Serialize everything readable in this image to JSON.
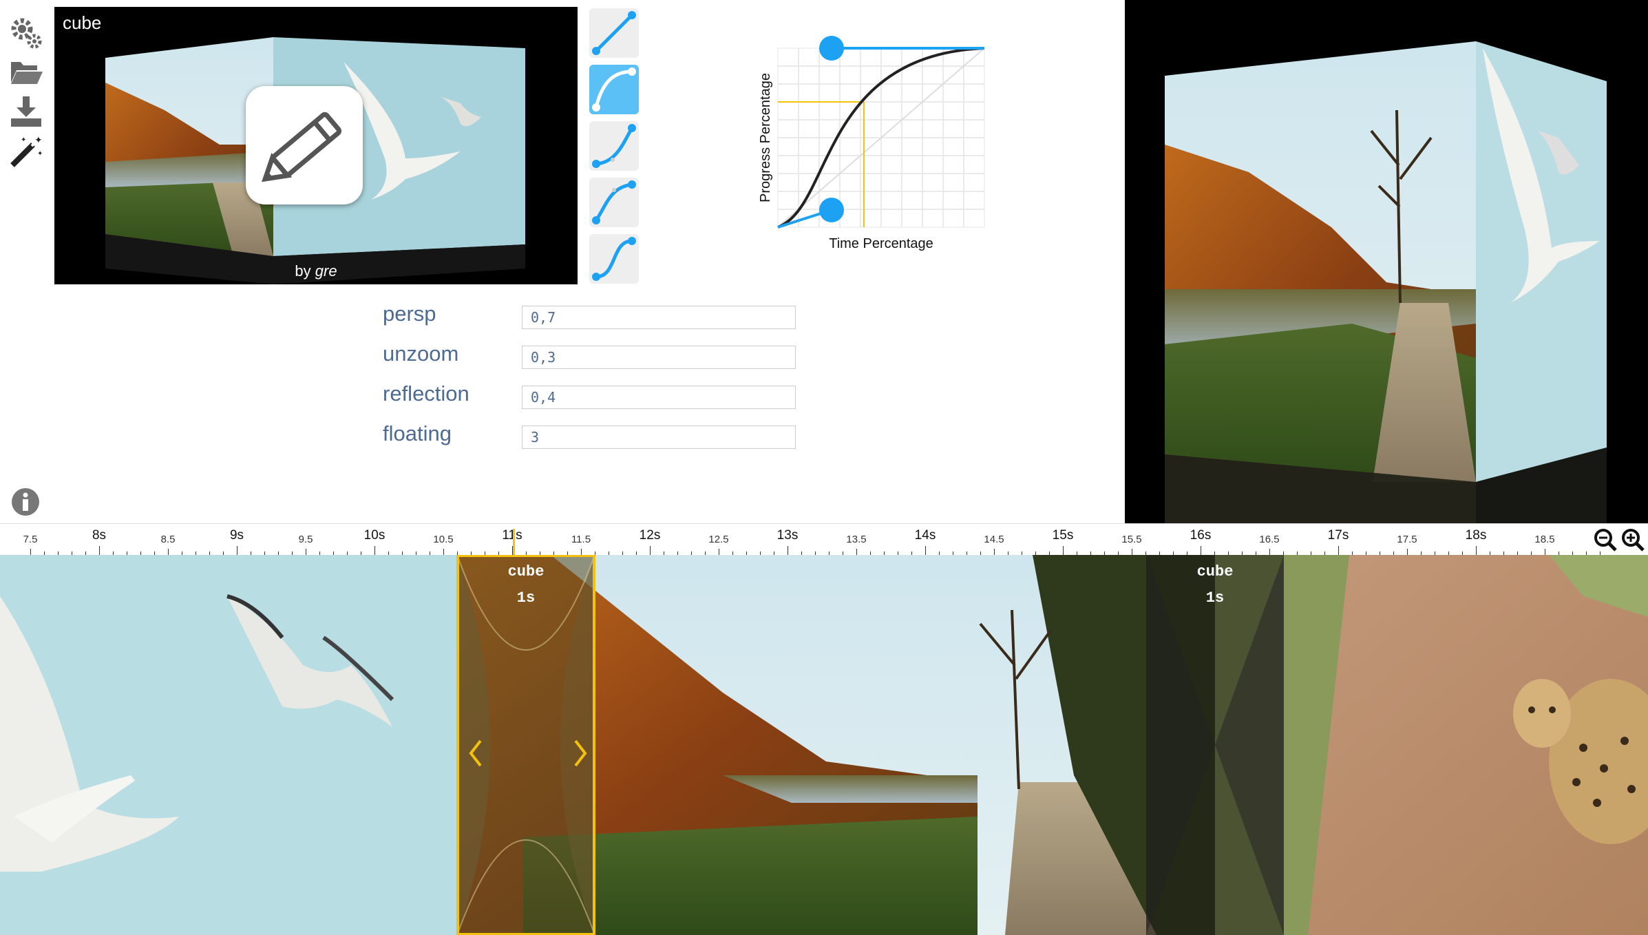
{
  "toolbar": {
    "items": [
      {
        "icon": "gear-icon"
      },
      {
        "icon": "folder-open-icon"
      },
      {
        "icon": "download-icon"
      },
      {
        "icon": "magic-wand-icon"
      }
    ],
    "info_icon": "info-icon"
  },
  "preview": {
    "title": "cube",
    "author_prefix": "by ",
    "author": "gre"
  },
  "easing": {
    "presets": [
      "linear",
      "ease",
      "ease-in",
      "ease-out",
      "ease-in-out"
    ],
    "active_index": 1,
    "graph": {
      "xlabel": "Time Percentage",
      "ylabel": "Progress Percentage"
    }
  },
  "params": [
    {
      "name": "persp",
      "value": "0,7"
    },
    {
      "name": "unzoom",
      "value": "0,3"
    },
    {
      "name": "reflection",
      "value": "0,4"
    },
    {
      "name": "floating",
      "value": "3"
    }
  ],
  "timeline": {
    "ticks": [
      {
        "label": "7.5",
        "major": false
      },
      {
        "label": "8s",
        "major": true
      },
      {
        "label": "8.5",
        "major": false
      },
      {
        "label": "9s",
        "major": true
      },
      {
        "label": "9.5",
        "major": false
      },
      {
        "label": "10s",
        "major": true
      },
      {
        "label": "10.5",
        "major": false
      },
      {
        "label": "11s",
        "major": true
      },
      {
        "label": "11.5",
        "major": false
      },
      {
        "label": "12s",
        "major": true
      },
      {
        "label": "12.5",
        "major": false
      },
      {
        "label": "13s",
        "major": true
      },
      {
        "label": "13.5",
        "major": false
      },
      {
        "label": "14s",
        "major": true
      },
      {
        "label": "14.5",
        "major": false
      },
      {
        "label": "15s",
        "major": true
      },
      {
        "label": "15.5",
        "major": false
      },
      {
        "label": "16s",
        "major": true
      },
      {
        "label": "16.5",
        "major": false
      },
      {
        "label": "17s",
        "major": true
      },
      {
        "label": "17.5",
        "major": false
      },
      {
        "label": "18s",
        "major": true
      },
      {
        "label": "18.5",
        "major": false
      }
    ],
    "transitions": [
      {
        "name": "cube",
        "duration": "1s",
        "selected": true
      },
      {
        "name": "cube",
        "duration": "1s",
        "selected": false
      }
    ],
    "zoom_out_icon": "zoom-out-icon",
    "zoom_in_icon": "zoom-in-icon"
  },
  "colors": {
    "accent_blue": "#1da1f2",
    "selection_yellow": "#f4c20d",
    "label_blue": "#4d6a91"
  }
}
